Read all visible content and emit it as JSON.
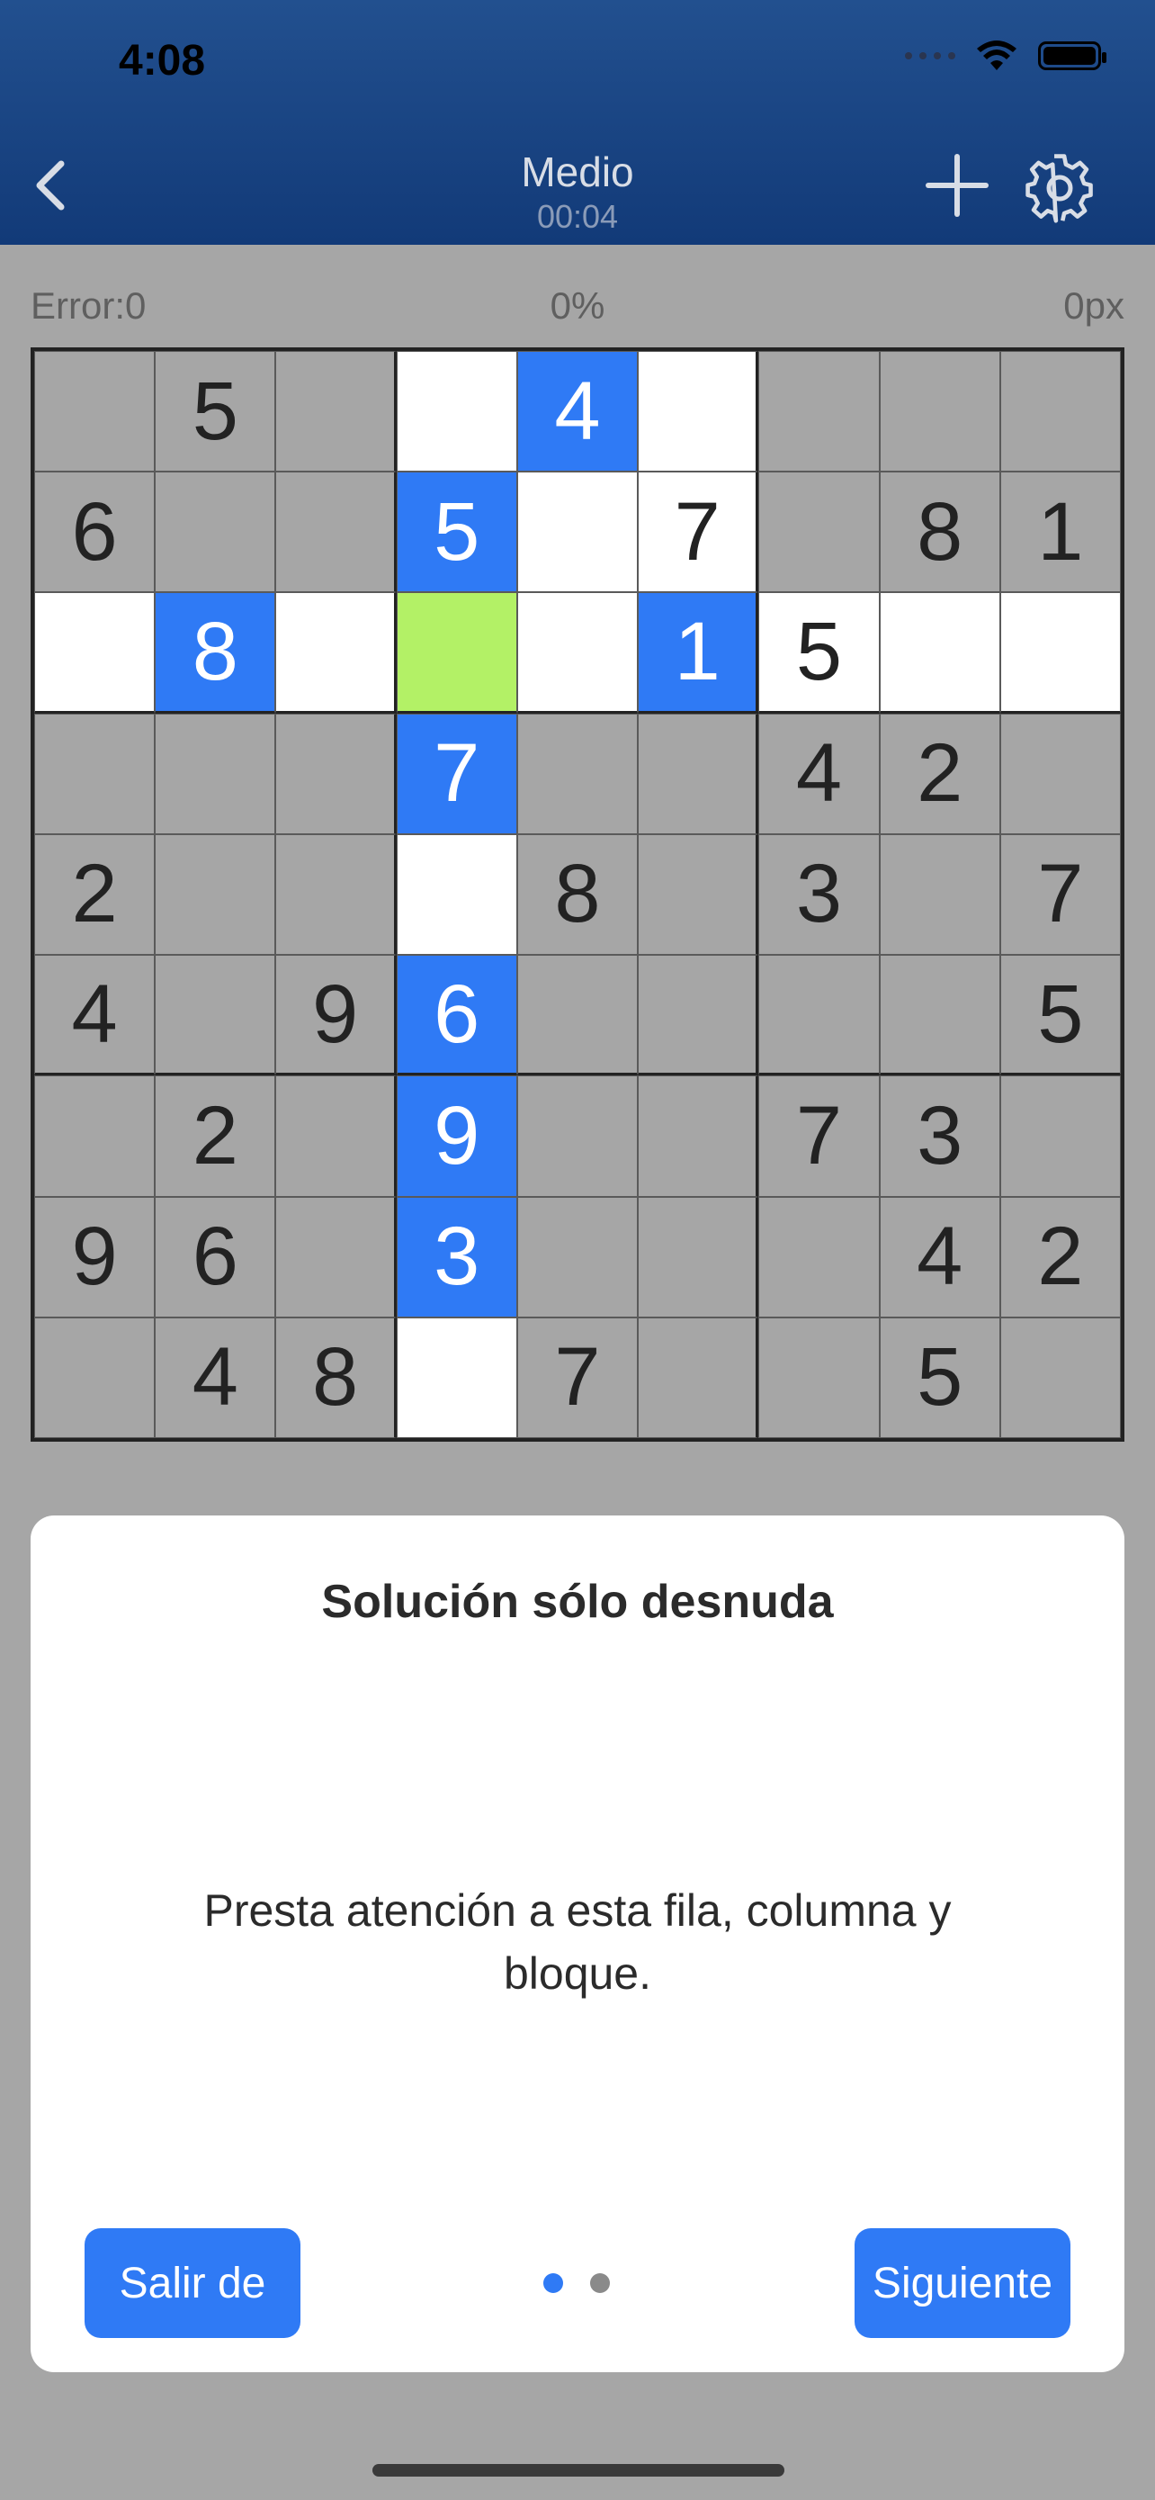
{
  "status_bar": {
    "time": "4:08"
  },
  "nav": {
    "title": "Medio",
    "timer": "00:04",
    "back_icon": "chevron-left-icon",
    "add_icon": "plus-icon",
    "settings_icon": "gear-icon"
  },
  "stats": {
    "errors": "Error:0",
    "progress": "0%",
    "points": "0px"
  },
  "board": {
    "rows": [
      [
        "",
        "5",
        "",
        "",
        "4",
        "",
        "",
        "",
        ""
      ],
      [
        "6",
        "",
        "",
        "5",
        "",
        "7",
        "",
        "8",
        "1"
      ],
      [
        "",
        "8",
        "",
        "",
        "",
        "1",
        "5",
        "",
        ""
      ],
      [
        "",
        "",
        "",
        "7",
        "",
        "",
        "4",
        "2",
        ""
      ],
      [
        "2",
        "",
        "",
        "",
        "8",
        "",
        "3",
        "",
        "7"
      ],
      [
        "4",
        "",
        "9",
        "6",
        "",
        "",
        "",
        "",
        "5"
      ],
      [
        "",
        "2",
        "",
        "9",
        "",
        "",
        "7",
        "3",
        ""
      ],
      [
        "9",
        "6",
        "",
        "3",
        "",
        "",
        "",
        "4",
        "2"
      ],
      [
        "",
        "4",
        "8",
        "",
        "7",
        "",
        "",
        "5",
        ""
      ]
    ],
    "highlight": [
      [
        "g",
        "g",
        "g",
        "w",
        "b",
        "w",
        "g",
        "g",
        "g"
      ],
      [
        "g",
        "g",
        "g",
        "b",
        "w",
        "w",
        "g",
        "g",
        "g"
      ],
      [
        "w",
        "b",
        "w",
        "t",
        "w",
        "b",
        "w",
        "w",
        "w"
      ],
      [
        "g",
        "g",
        "g",
        "b",
        "g",
        "g",
        "g",
        "g",
        "g"
      ],
      [
        "g",
        "g",
        "g",
        "w",
        "g",
        "g",
        "g",
        "g",
        "g"
      ],
      [
        "g",
        "g",
        "g",
        "b",
        "g",
        "g",
        "g",
        "g",
        "g"
      ],
      [
        "g",
        "g",
        "g",
        "b",
        "g",
        "g",
        "g",
        "g",
        "g"
      ],
      [
        "g",
        "g",
        "g",
        "b",
        "g",
        "g",
        "g",
        "g",
        "g"
      ],
      [
        "g",
        "g",
        "g",
        "w",
        "g",
        "g",
        "g",
        "g",
        "g"
      ]
    ],
    "colors": {
      "blue": "#2f7af5",
      "target": "#b3f166",
      "white": "#ffffff",
      "gray": "#a6a6a6"
    }
  },
  "hint": {
    "title": "Solución sólo desnuda",
    "body": "Presta atención a esta fila, columna y bloque.",
    "exit_label": "Salir de",
    "next_label": "Siguiente",
    "page_count": 2,
    "current_page": 1
  }
}
